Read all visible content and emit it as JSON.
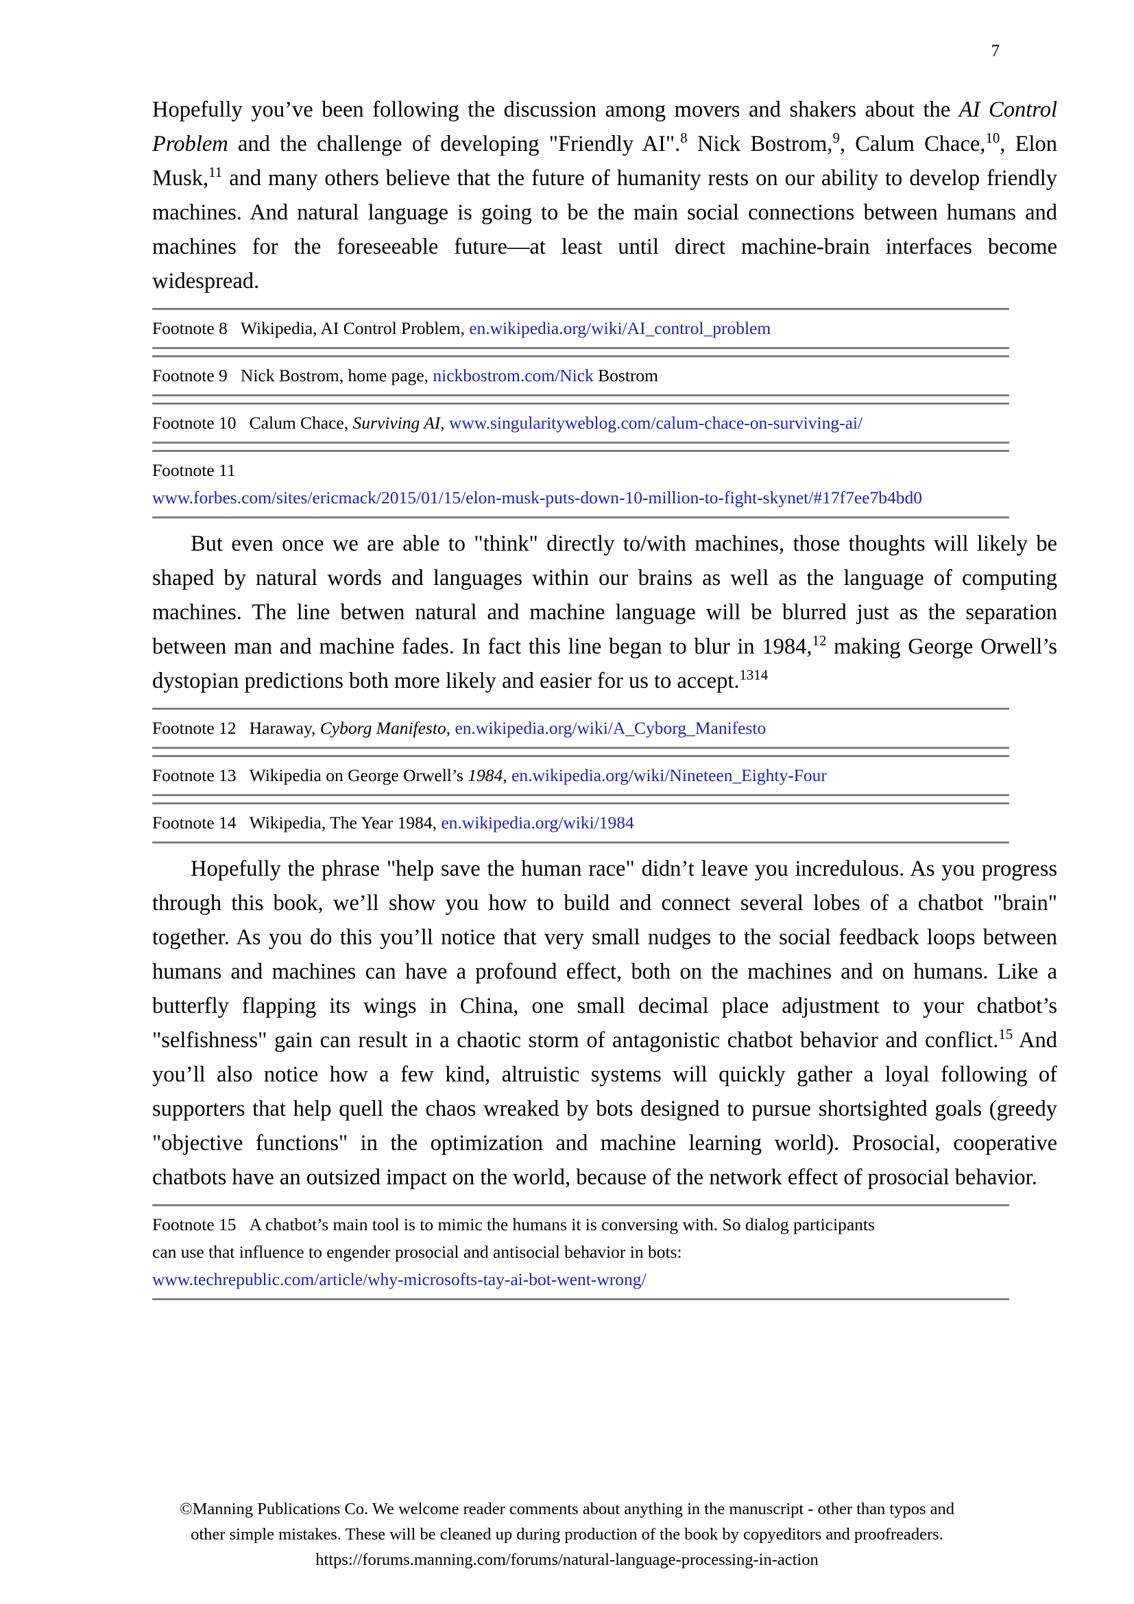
{
  "page": {
    "number": "7"
  },
  "paragraphs": {
    "p1": {
      "seg1": "Hopefully you’ve been following the discussion among movers and shakers about the ",
      "italic1": "AI Control Problem",
      "seg2": " and the challenge of developing \"Friendly AI\".",
      "sup1": "8",
      "seg3": " Nick Bostrom,",
      "sup2": "9",
      "seg4": ", Calum Chace,",
      "sup3": "10",
      "seg5": ", Elon Musk,",
      "sup4": "11",
      "seg6": " and many others believe that the future of humanity rests on our ability to develop friendly machines. And natural language is going to be the main social connections between humans and machines for the foreseeable future—at least until direct machine-brain interfaces become widespread."
    },
    "p2": {
      "seg1": "But even once we are able to \"think\" directly to/with machines, those thoughts will likely be shaped by natural words and languages within our brains as well as the language of computing machines. The line betwen natural and machine language will be blurred just as the separation between man and machine fades. In fact this line began to blur in 1984,",
      "sup1": "12",
      "seg2": " making George Orwell’s dystopian predictions both more likely and easier for us to accept.",
      "sup2": "1314"
    },
    "p3": {
      "seg1": "Hopefully the phrase \"help save the human race\" didn’t leave you incredulous. As you progress through this book, we’ll show you how to build and connect several lobes of a chatbot \"brain\" together. As you do this you’ll notice that very small nudges to the social feedback loops between humans and machines can have a profound effect, both on the machines and on humans. Like a butterfly flapping its wings in China, one small decimal place adjustment to your chatbot’s \"selfishness\" gain can result in a chaotic storm of antagonistic chatbot behavior and conflict.",
      "sup1": "15",
      "seg2": " And you’ll also notice how a few kind, altruistic systems will quickly gather a loyal following of supporters that help quell the chaos wreaked by bots designed to pursue shortsighted goals (greedy \"objective functions\" in the optimization and machine learning world). Prosocial, cooperative chatbots have an outsized impact on the world, because of the network effect of prosocial behavior."
    }
  },
  "footnotes_group_1": [
    {
      "label": "Footnote 8",
      "text_before": "Wikipedia, AI Control Problem, ",
      "italic": "",
      "url": "en.wikipedia.org/wiki/AI_control_problem",
      "text_after": ""
    },
    {
      "label": "Footnote 9",
      "text_before": "Nick Bostrom, home page, ",
      "italic": "",
      "url": "nickbostrom.com/Nick",
      "text_after": " Bostrom"
    },
    {
      "label": "Footnote 10",
      "text_before": "Calum Chace, ",
      "italic": "Surviving AI",
      "text_mid": ", ",
      "url": "www.singularityweblog.com/calum-chace-on-surviving-ai/",
      "text_after": ""
    },
    {
      "label": "Footnote 11",
      "text_before": "",
      "italic": "",
      "url": "www.forbes.com/sites/ericmack/2015/01/15/elon-musk-puts-down-10-million-to-fight-skynet/#17f7ee7b4bd0",
      "text_after": "",
      "two_line": true
    }
  ],
  "footnotes_group_2": [
    {
      "label": "Footnote 12",
      "text_before": "Haraway, ",
      "italic": "Cyborg Manifesto",
      "text_mid": ", ",
      "url": "en.wikipedia.org/wiki/A_Cyborg_Manifesto",
      "text_after": ""
    },
    {
      "label": "Footnote 13",
      "text_before": "Wikipedia on George Orwell’s ",
      "italic": "1984",
      "text_mid": ", ",
      "url": "en.wikipedia.org/wiki/Nineteen_Eighty-Four",
      "text_after": ""
    },
    {
      "label": "Footnote 14",
      "text_before": "Wikipedia, The Year 1984, ",
      "italic": "",
      "url": "en.wikipedia.org/wiki/1984",
      "text_after": ""
    }
  ],
  "footnotes_group_3": [
    {
      "label": "Footnote 15",
      "line1": "A chatbot’s main tool is to mimic the humans it is conversing with. So dialog participants",
      "line2": "can use that influence to engender prosocial and antisocial behavior in bots:",
      "url": "www.techrepublic.com/article/why-microsofts-tay-ai-bot-went-wrong/"
    }
  ],
  "footer": {
    "line1": "©Manning Publications Co. We welcome reader comments about anything in the manuscript - other than typos and",
    "line2": "other simple mistakes. These will be cleaned up during production of the book by copyeditors and proofreaders.",
    "line3": "https://forums.manning.com/forums/natural-language-processing-in-action"
  },
  "colors": {
    "link": "#2222aa",
    "rule": "#808080",
    "text": "#000000"
  }
}
